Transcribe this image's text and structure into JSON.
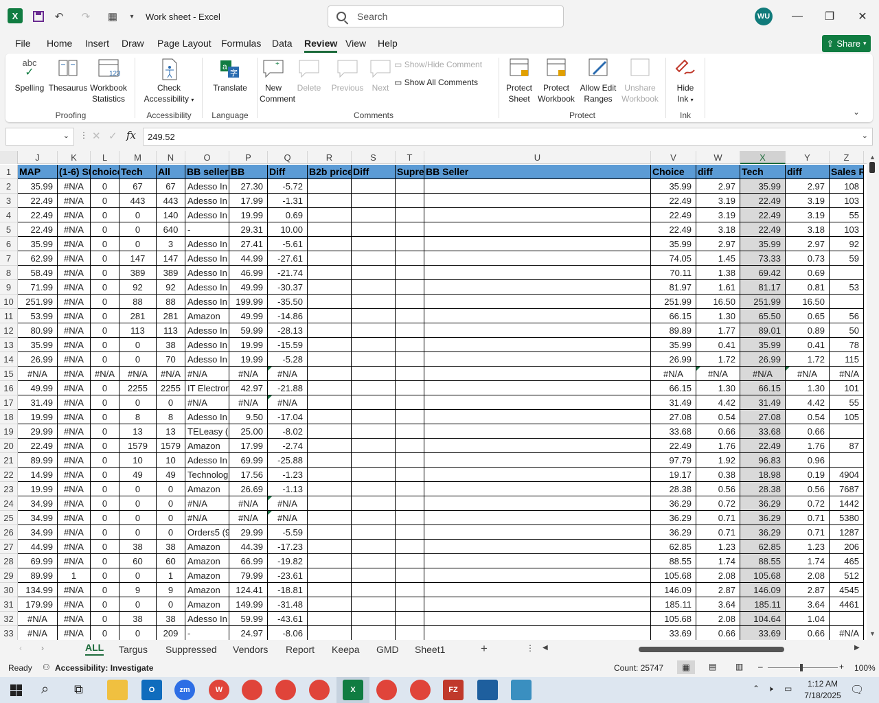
{
  "titlebar": {
    "title": "Work sheet  -  Excel",
    "search_placeholder": "Search",
    "avatar": "WU"
  },
  "menu": [
    "File",
    "Home",
    "Insert",
    "Draw",
    "Page Layout",
    "Formulas",
    "Data",
    "Review",
    "View",
    "Help"
  ],
  "share_label": "Share",
  "ribbon": {
    "spelling": "Spelling",
    "thesaurus": "Thesaurus",
    "workbook": "Workbook",
    "statistics": "Statistics",
    "check": "Check",
    "accessibility": "Accessibility",
    "translate": "Translate",
    "new": "New",
    "comment": "Comment",
    "delete": "Delete",
    "previous": "Previous",
    "next": "Next",
    "show_hide_comment": "Show/Hide Comment",
    "show_all_comments": "Show All Comments",
    "protect": "Protect",
    "sheet": "Sheet",
    "workbook2": "Workbook",
    "allow_edit": "Allow Edit",
    "ranges": "Ranges",
    "unshare": "Unshare",
    "hide": "Hide",
    "ink": "Ink",
    "groups": {
      "proofing": "Proofing",
      "accessibility": "Accessibility",
      "language": "Language",
      "comments": "Comments",
      "protect": "Protect",
      "ink": "Ink"
    }
  },
  "formula_value": "249.52",
  "columns": [
    {
      "l": "J",
      "w": 58
    },
    {
      "l": "K",
      "w": 48
    },
    {
      "l": "L",
      "w": 42
    },
    {
      "l": "M",
      "w": 54
    },
    {
      "l": "N",
      "w": 42
    },
    {
      "l": "O",
      "w": 64
    },
    {
      "l": "P",
      "w": 56
    },
    {
      "l": "Q",
      "w": 58
    },
    {
      "l": "R",
      "w": 64
    },
    {
      "l": "S",
      "w": 64
    },
    {
      "l": "T",
      "w": 42
    },
    {
      "l": "U",
      "w": 330
    },
    {
      "l": "V",
      "w": 66
    },
    {
      "l": "W",
      "w": 64
    },
    {
      "l": "X",
      "w": 66
    },
    {
      "l": "Y",
      "w": 64
    },
    {
      "l": "Z",
      "w": 50
    }
  ],
  "headers": [
    "MAP",
    "(1-6) St",
    "choice",
    "Tech",
    "All",
    "BB sellers",
    "BB",
    "Diff",
    "B2b price",
    "Diff",
    "Supre",
    "BB Seller",
    "Choice",
    "diff",
    "Tech",
    "diff",
    "Sales R"
  ],
  "rows": [
    [
      "35.99",
      "#N/A",
      "0",
      "67",
      "67",
      "Adesso In",
      "27.30",
      "-5.72",
      "",
      "",
      "",
      "",
      "35.99",
      "2.97",
      "35.99",
      "2.97",
      "108"
    ],
    [
      "22.49",
      "#N/A",
      "0",
      "443",
      "443",
      "Adesso In",
      "17.99",
      "-1.31",
      "",
      "",
      "",
      "",
      "22.49",
      "3.19",
      "22.49",
      "3.19",
      "103"
    ],
    [
      "22.49",
      "#N/A",
      "0",
      "0",
      "140",
      "Adesso In",
      "19.99",
      "0.69",
      "",
      "",
      "",
      "",
      "22.49",
      "3.19",
      "22.49",
      "3.19",
      "55"
    ],
    [
      "22.49",
      "#N/A",
      "0",
      "0",
      "640",
      "-",
      "29.31",
      "10.00",
      "",
      "",
      "",
      "",
      "22.49",
      "3.18",
      "22.49",
      "3.18",
      "103"
    ],
    [
      "35.99",
      "#N/A",
      "0",
      "0",
      "3",
      "Adesso In",
      "27.41",
      "-5.61",
      "",
      "",
      "",
      "",
      "35.99",
      "2.97",
      "35.99",
      "2.97",
      "92"
    ],
    [
      "62.99",
      "#N/A",
      "0",
      "147",
      "147",
      "Adesso In",
      "44.99",
      "-27.61",
      "",
      "",
      "",
      "",
      "74.05",
      "1.45",
      "73.33",
      "0.73",
      "59"
    ],
    [
      "58.49",
      "#N/A",
      "0",
      "389",
      "389",
      "Adesso In",
      "46.99",
      "-21.74",
      "",
      "",
      "",
      "",
      "70.11",
      "1.38",
      "69.42",
      "0.69",
      ""
    ],
    [
      "71.99",
      "#N/A",
      "0",
      "92",
      "92",
      "Adesso In",
      "49.99",
      "-30.37",
      "",
      "",
      "",
      "",
      "81.97",
      "1.61",
      "81.17",
      "0.81",
      "53"
    ],
    [
      "251.99",
      "#N/A",
      "0",
      "88",
      "88",
      "Adesso In",
      "199.99",
      "-35.50",
      "",
      "",
      "",
      "",
      "251.99",
      "16.50",
      "251.99",
      "16.50",
      ""
    ],
    [
      "53.99",
      "#N/A",
      "0",
      "281",
      "281",
      "Amazon",
      "49.99",
      "-14.86",
      "",
      "",
      "",
      "",
      "66.15",
      "1.30",
      "65.50",
      "0.65",
      "56"
    ],
    [
      "80.99",
      "#N/A",
      "0",
      "113",
      "113",
      "Adesso In",
      "59.99",
      "-28.13",
      "",
      "",
      "",
      "",
      "89.89",
      "1.77",
      "89.01",
      "0.89",
      "50"
    ],
    [
      "35.99",
      "#N/A",
      "0",
      "0",
      "38",
      "Adesso In",
      "19.99",
      "-15.59",
      "",
      "",
      "",
      "",
      "35.99",
      "0.41",
      "35.99",
      "0.41",
      "78"
    ],
    [
      "26.99",
      "#N/A",
      "0",
      "0",
      "70",
      "Adesso In",
      "19.99",
      "-5.28",
      "",
      "",
      "",
      "",
      "26.99",
      "1.72",
      "26.99",
      "1.72",
      "115"
    ],
    [
      "#N/A",
      "#N/A",
      "#N/A",
      "#N/A",
      "#N/A",
      "#N/A",
      "#N/A",
      "#N/A",
      "",
      "",
      "",
      "",
      "#N/A",
      "#N/A",
      "#N/A",
      "#N/A",
      "#N/A"
    ],
    [
      "49.99",
      "#N/A",
      "0",
      "2255",
      "2255",
      "IT Electron",
      "42.97",
      "-21.88",
      "",
      "",
      "",
      "",
      "66.15",
      "1.30",
      "66.15",
      "1.30",
      "101"
    ],
    [
      "31.49",
      "#N/A",
      "0",
      "0",
      "0",
      "#N/A",
      "#N/A",
      "#N/A",
      "",
      "",
      "",
      "",
      "31.49",
      "4.42",
      "31.49",
      "4.42",
      "55"
    ],
    [
      "19.99",
      "#N/A",
      "0",
      "8",
      "8",
      "Adesso In",
      "9.50",
      "-17.04",
      "",
      "",
      "",
      "",
      "27.08",
      "0.54",
      "27.08",
      "0.54",
      "105"
    ],
    [
      "29.99",
      "#N/A",
      "0",
      "13",
      "13",
      "TELeasy (6",
      "25.00",
      "-8.02",
      "",
      "",
      "",
      "",
      "33.68",
      "0.66",
      "33.68",
      "0.66",
      ""
    ],
    [
      "22.49",
      "#N/A",
      "0",
      "1579",
      "1579",
      "Amazon",
      "17.99",
      "-2.74",
      "",
      "",
      "",
      "",
      "22.49",
      "1.76",
      "22.49",
      "1.76",
      "87"
    ],
    [
      "89.99",
      "#N/A",
      "0",
      "10",
      "10",
      "Adesso In",
      "69.99",
      "-25.88",
      "",
      "",
      "",
      "",
      "97.79",
      "1.92",
      "96.83",
      "0.96",
      ""
    ],
    [
      "14.99",
      "#N/A",
      "0",
      "49",
      "49",
      "Technolog",
      "17.56",
      "-1.23",
      "",
      "",
      "",
      "",
      "19.17",
      "0.38",
      "18.98",
      "0.19",
      "4904"
    ],
    [
      "19.99",
      "#N/A",
      "0",
      "0",
      "0",
      "Amazon",
      "26.69",
      "-1.13",
      "",
      "",
      "",
      "",
      "28.38",
      "0.56",
      "28.38",
      "0.56",
      "7687"
    ],
    [
      "34.99",
      "#N/A",
      "0",
      "0",
      "0",
      "#N/A",
      "#N/A",
      "#N/A",
      "",
      "",
      "",
      "",
      "36.29",
      "0.72",
      "36.29",
      "0.72",
      "1442"
    ],
    [
      "34.99",
      "#N/A",
      "0",
      "0",
      "0",
      "#N/A",
      "#N/A",
      "#N/A",
      "",
      "",
      "",
      "",
      "36.29",
      "0.71",
      "36.29",
      "0.71",
      "5380"
    ],
    [
      "34.99",
      "#N/A",
      "0",
      "0",
      "0",
      "Orders5 (9",
      "29.99",
      "-5.59",
      "",
      "",
      "",
      "",
      "36.29",
      "0.71",
      "36.29",
      "0.71",
      "1287"
    ],
    [
      "44.99",
      "#N/A",
      "0",
      "38",
      "38",
      "Amazon",
      "44.39",
      "-17.23",
      "",
      "",
      "",
      "",
      "62.85",
      "1.23",
      "62.85",
      "1.23",
      "206"
    ],
    [
      "69.99",
      "#N/A",
      "0",
      "60",
      "60",
      "Amazon",
      "66.99",
      "-19.82",
      "",
      "",
      "",
      "",
      "88.55",
      "1.74",
      "88.55",
      "1.74",
      "465"
    ],
    [
      "89.99",
      "1",
      "0",
      "0",
      "1",
      "Amazon",
      "79.99",
      "-23.61",
      "",
      "",
      "",
      "",
      "105.68",
      "2.08",
      "105.68",
      "2.08",
      "512"
    ],
    [
      "134.99",
      "#N/A",
      "0",
      "9",
      "9",
      "Amazon",
      "124.41",
      "-18.81",
      "",
      "",
      "",
      "",
      "146.09",
      "2.87",
      "146.09",
      "2.87",
      "4545"
    ],
    [
      "179.99",
      "#N/A",
      "0",
      "0",
      "0",
      "Amazon",
      "149.99",
      "-31.48",
      "",
      "",
      "",
      "",
      "185.11",
      "3.64",
      "185.11",
      "3.64",
      "4461"
    ],
    [
      "#N/A",
      "#N/A",
      "0",
      "38",
      "38",
      "Adesso In",
      "59.99",
      "-43.61",
      "",
      "",
      "",
      "",
      "105.68",
      "2.08",
      "104.64",
      "1.04",
      ""
    ],
    [
      "#N/A",
      "#N/A",
      "0",
      "0",
      "209",
      "-",
      "24.97",
      "-8.06",
      "",
      "",
      "",
      "",
      "33.69",
      "0.66",
      "33.69",
      "0.66",
      "#N/A"
    ]
  ],
  "tabs": [
    "ALL",
    "Targus",
    "Suppressed",
    "Vendors",
    "Report",
    "Keepa",
    "GMD",
    "Sheet1"
  ],
  "status": {
    "ready": "Ready",
    "accessibility": "Accessibility: Investigate",
    "count": "Count: 25747",
    "zoom": "100%"
  },
  "clock": {
    "time": "1:12 AM",
    "date": "7/18/2025"
  }
}
